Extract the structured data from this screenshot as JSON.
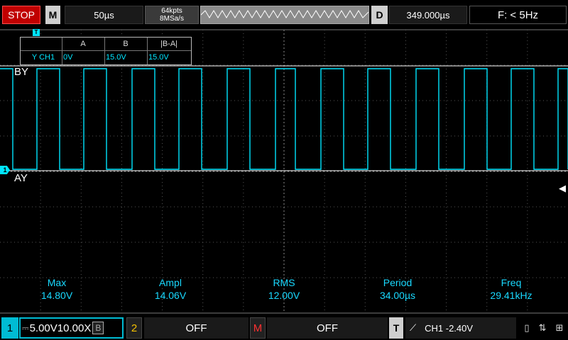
{
  "topbar": {
    "run_state": "STOP",
    "menu_key": "M",
    "timebase": "50µs",
    "memory_depth": "64kpts",
    "sample_rate": "8MSa/s",
    "delay_key": "D",
    "delay": "349.000µs",
    "freq_counter": "F: < 5Hz"
  },
  "cursor_table": {
    "marker": "T",
    "headers": [
      "A",
      "B",
      "|B-A|"
    ],
    "row_label": "Y CH1",
    "values": [
      "0V",
      "15.0V",
      "15.0V"
    ]
  },
  "cursors": {
    "b_label": "BY",
    "a_label": "AY"
  },
  "channel_marker": "1",
  "measurements": [
    {
      "name": "Max",
      "value": "14.80V"
    },
    {
      "name": "Ampl",
      "value": "14.06V"
    },
    {
      "name": "RMS",
      "value": "12.00V"
    },
    {
      "name": "Period",
      "value": "34.00µs"
    },
    {
      "name": "Freq",
      "value": "29.41kHz"
    }
  ],
  "bottombar": {
    "ch1_num": "1",
    "ch1_scale": "5.00V",
    "ch1_probe": "10.00X",
    "ch1_bw": "B",
    "ch2_num": "2",
    "ch2_state": "OFF",
    "math_num": "M",
    "math_state": "OFF",
    "trigger_key": "T",
    "trigger_source": "CH1",
    "trigger_level": "-2.40V"
  },
  "colors": {
    "ch1": "#00e5ff",
    "ch2": "#f4c000",
    "math": "#ff3030",
    "stop": "#c00000",
    "measurement_text": "#19d9ff"
  },
  "icons": [
    "usb-icon",
    "lan-icon",
    "network-icon",
    "rising-edge-icon",
    "dc-coupling-icon"
  ]
}
